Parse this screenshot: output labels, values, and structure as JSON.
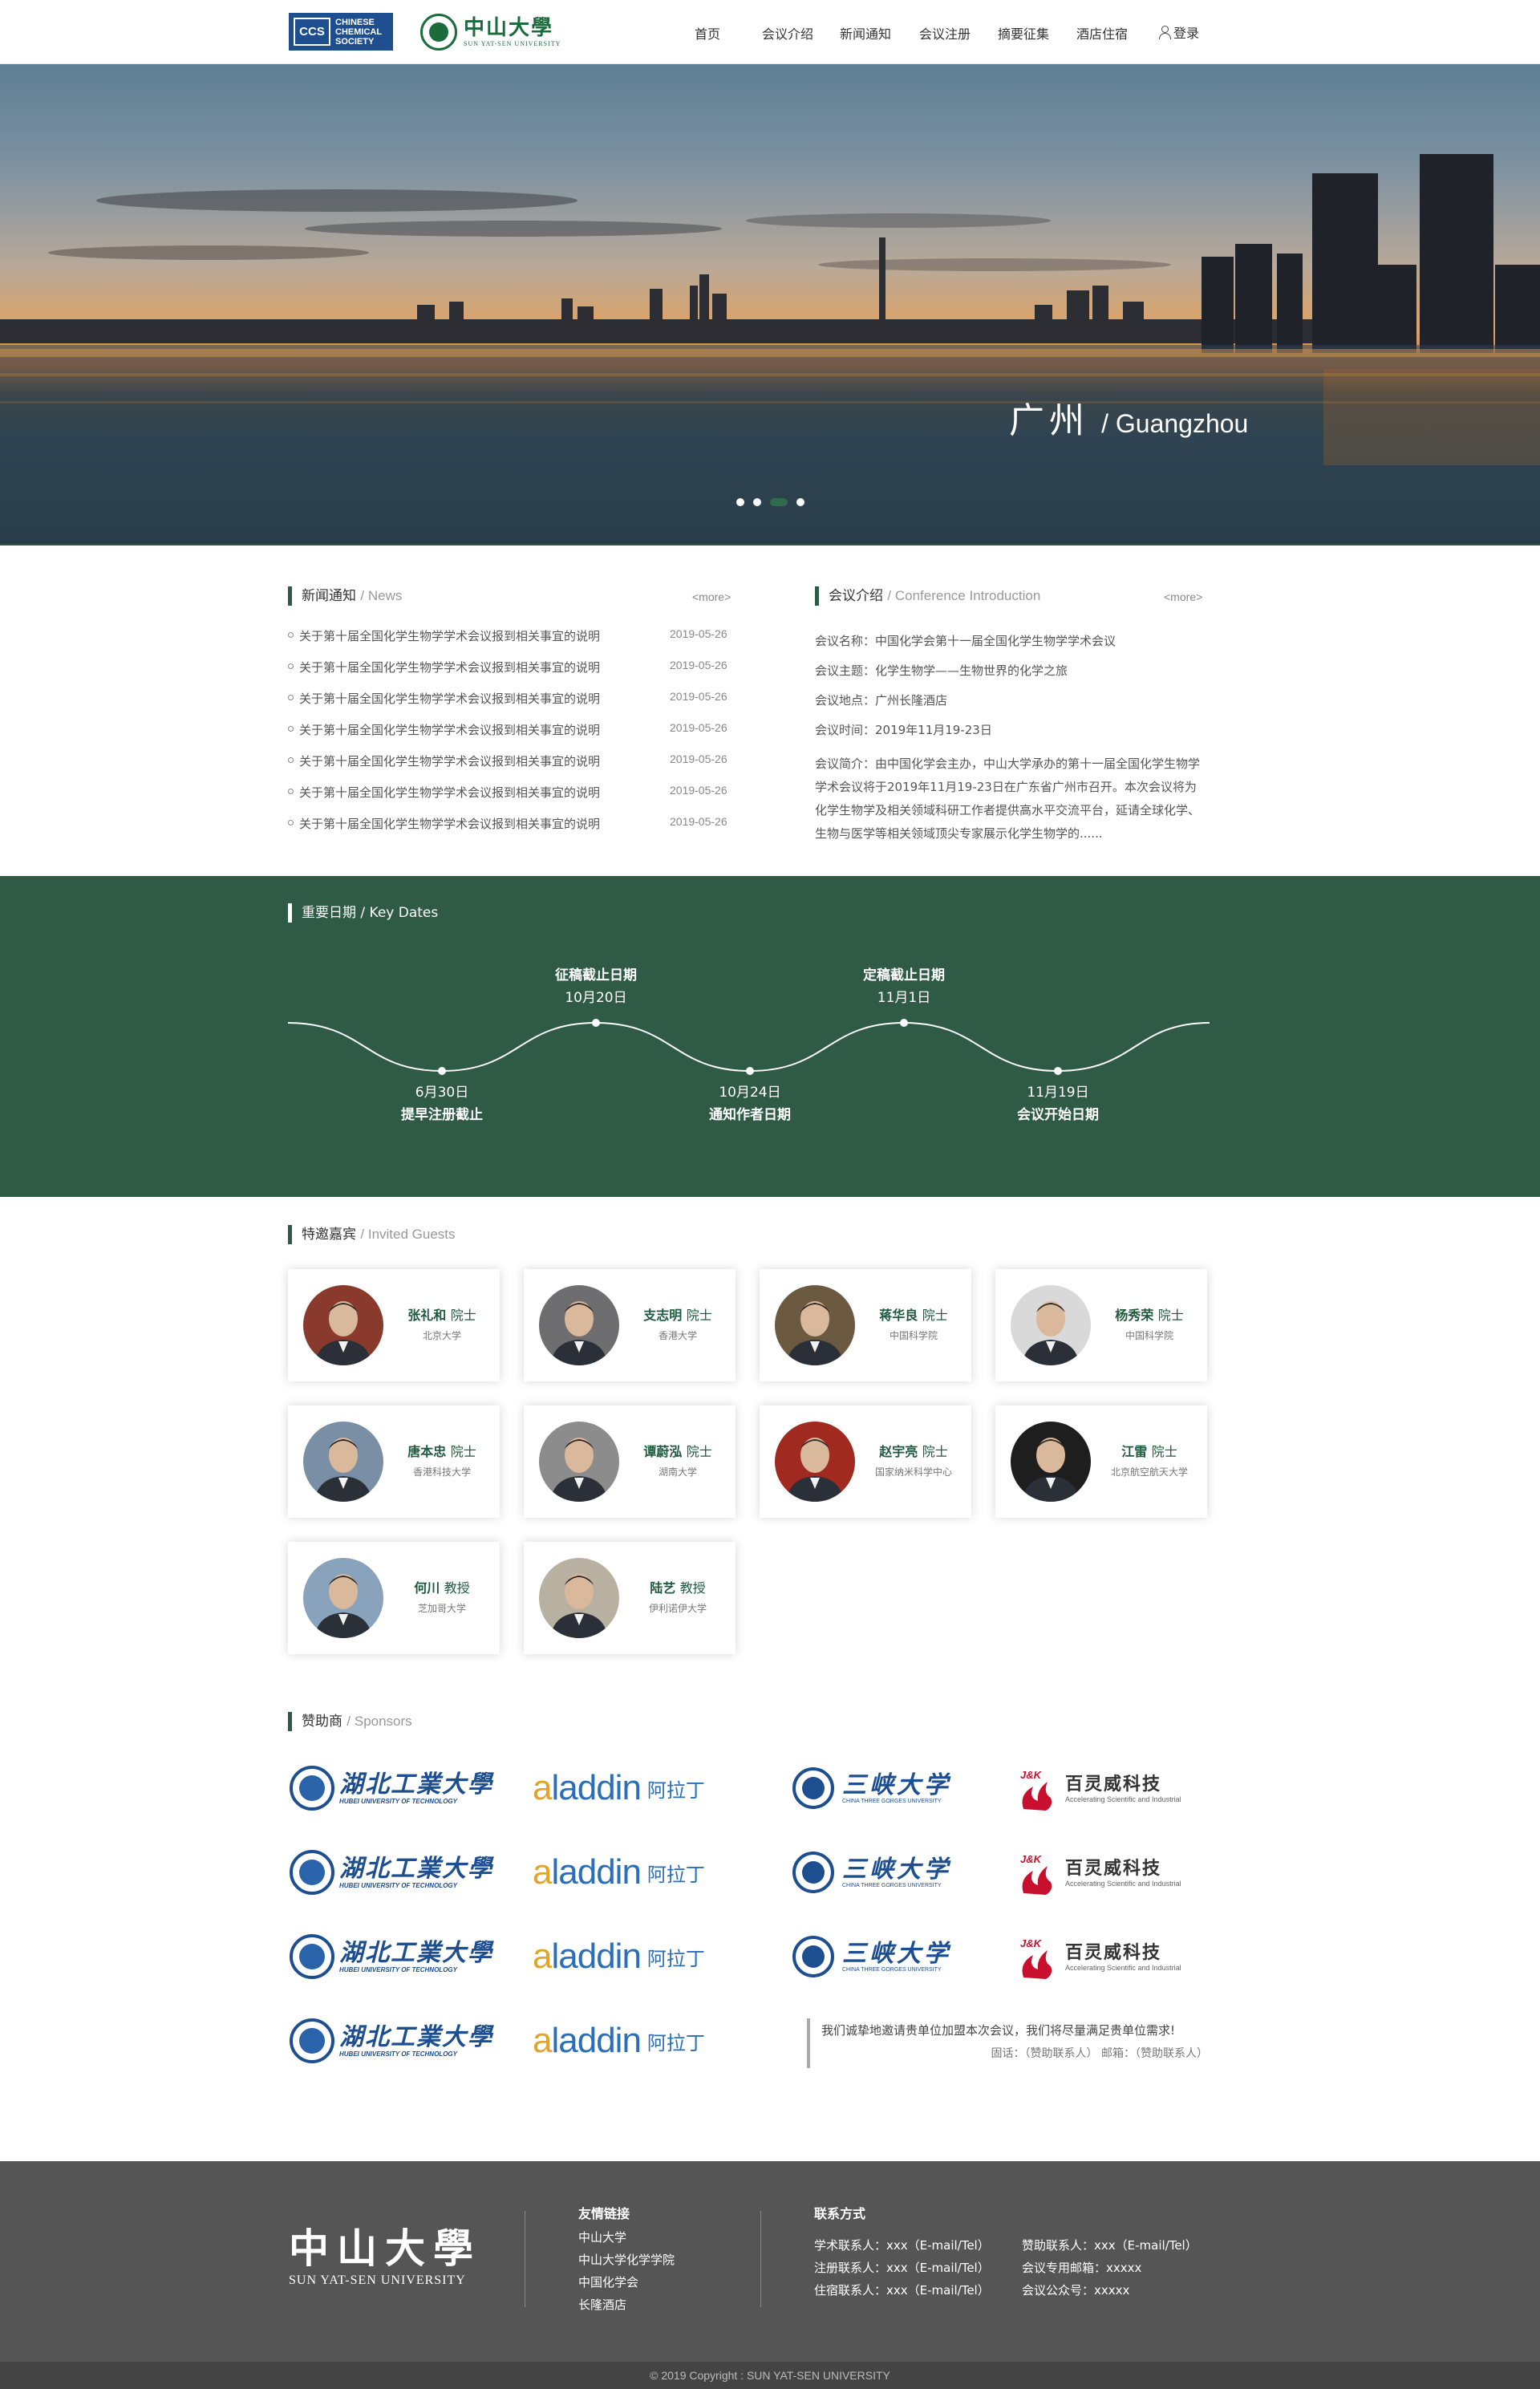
{
  "header": {
    "ccs_logo": {
      "abbr": "CCS",
      "line1": "CHINESE",
      "line2": "CHEMICAL",
      "line3": "SOCIETY"
    },
    "sysu_logo": {
      "cn": "中山大學",
      "en": "SUN YAT-SEN UNIVERSITY"
    },
    "nav": [
      "首页",
      "会议介绍",
      "新闻通知",
      "会议注册",
      "摘要征集",
      "酒店住宿"
    ],
    "login": "登录"
  },
  "banner": {
    "city_cn": "广州",
    "city_en": "/ Guangzhou",
    "slides": 4,
    "active_slide": 3
  },
  "news": {
    "title": "新闻通知",
    "title_en": "/ News",
    "more": "<more>",
    "items": [
      {
        "title": "关于第十届全国化学生物学学术会议报到相关事宜的说明",
        "date": "2019-05-26"
      },
      {
        "title": "关于第十届全国化学生物学学术会议报到相关事宜的说明",
        "date": "2019-05-26"
      },
      {
        "title": "关于第十届全国化学生物学学术会议报到相关事宜的说明",
        "date": "2019-05-26"
      },
      {
        "title": "关于第十届全国化学生物学学术会议报到相关事宜的说明",
        "date": "2019-05-26"
      },
      {
        "title": "关于第十届全国化学生物学学术会议报到相关事宜的说明",
        "date": "2019-05-26"
      },
      {
        "title": "关于第十届全国化学生物学学术会议报到相关事宜的说明",
        "date": "2019-05-26"
      },
      {
        "title": "关于第十届全国化学生物学学术会议报到相关事宜的说明",
        "date": "2019-05-26"
      }
    ]
  },
  "intro": {
    "title": "会议介绍",
    "title_en": "/ Conference Introduction",
    "more": "<more>",
    "name": "会议名称：中国化学会第十一届全国化学生物学学术会议",
    "theme": "会议主题：化学生物学——生物世界的化学之旅",
    "place": "会议地点：广州长隆酒店",
    "time": "会议时间：2019年11月19-23日",
    "summary": "会议简介：由中国化学会主办，中山大学承办的第十一届全国化学生物学学术会议将于2019年11月19-23日在广东省广州市召开。本次会议将为化学生物学及相关领域科研工作者提供高水平交流平台，延请全球化学、生物与医学等相关领域顶尖专家展示化学生物学的......"
  },
  "keydates": {
    "title": "重要日期 / Key Dates",
    "items": [
      {
        "date": "6月30日",
        "label": "提早注册截止",
        "pos": "bottom"
      },
      {
        "date": "10月20日",
        "label": "征稿截止日期",
        "pos": "top"
      },
      {
        "date": "10月24日",
        "label": "通知作者日期",
        "pos": "bottom"
      },
      {
        "date": "11月1日",
        "label": "定稿截止日期",
        "pos": "top"
      },
      {
        "date": "11月19日",
        "label": "会议开始日期",
        "pos": "bottom"
      }
    ]
  },
  "guests": {
    "title": "特邀嘉宾",
    "title_en": "/ Invited Guests",
    "items": [
      {
        "name": "张礼和",
        "title": "院士",
        "org": "北京大学",
        "bg": "#8a3a2c"
      },
      {
        "name": "支志明",
        "title": "院士",
        "org": "香港大学",
        "bg": "#6e6e70"
      },
      {
        "name": "蒋华良",
        "title": "院士",
        "org": "中国科学院",
        "bg": "#6b5a3f"
      },
      {
        "name": "杨秀荣",
        "title": "院士",
        "org": "中国科学院",
        "bg": "#d9d9d9"
      },
      {
        "name": "唐本忠",
        "title": "院士",
        "org": "香港科技大学",
        "bg": "#7a8fa5"
      },
      {
        "name": "谭蔚泓",
        "title": "院士",
        "org": "湖南大学",
        "bg": "#8c8c8c"
      },
      {
        "name": "赵宇亮",
        "title": "院士",
        "org": "国家纳米科学中心",
        "bg": "#a12a20"
      },
      {
        "name": "江雷",
        "title": "院士",
        "org": "北京航空航天大学",
        "bg": "#1e1e1e"
      },
      {
        "name": "何川",
        "title": "教授",
        "org": "芝加哥大学",
        "bg": "#8aa3bd"
      },
      {
        "name": "陆艺",
        "title": "教授",
        "org": "伊利诺伊大学",
        "bg": "#b8b0a0"
      }
    ]
  },
  "sponsors": {
    "title": "赞助商",
    "title_en": "/ Sponsors",
    "hubei": {
      "cn": "湖北工業大學",
      "en": "HUBEI UNIVERSITY OF TECHNOLOGY"
    },
    "aladdin": {
      "word_a": "a",
      "word_rest": "laddin",
      "cn": "阿拉丁"
    },
    "sanxia": {
      "cn": "三峡大学",
      "en": "CHINA THREE GORGES UNIVERSITY"
    },
    "jk": {
      "badge": "J&K",
      "cn": "百灵威科技",
      "en": "Accelerating Scientific and Industrial"
    },
    "note_line1": "我们诚挚地邀请贵单位加盟本次会议，我们将尽量满足贵单位需求!",
    "note_line2": "固话：（赞助联系人）      邮箱：（赞助联系人）"
  },
  "footer": {
    "logo_cn": "中山大學",
    "logo_en": "SUN YAT-SEN UNIVERSITY",
    "links_title": "友情链接",
    "links": [
      "中山大学",
      "中山大学化学学院",
      "中国化学会",
      "长隆酒店"
    ],
    "contact_title": "联系方式",
    "contacts_left": [
      "学术联系人：xxx（E-mail/Tel）",
      "注册联系人：xxx（E-mail/Tel）",
      "住宿联系人：xxx（E-mail/Tel）"
    ],
    "contacts_right": [
      "赞助联系人：xxx（E-mail/Tel）",
      "会议专用邮箱：xxxxx",
      "会议公众号：xxxxx"
    ],
    "copyright": "© 2019 Copyright : SUN YAT-SEN UNIVERSITY"
  },
  "colors": {
    "primary_green": "#2e5a46",
    "footer_gray": "#555555",
    "brand_blue": "#1d4e8f"
  }
}
